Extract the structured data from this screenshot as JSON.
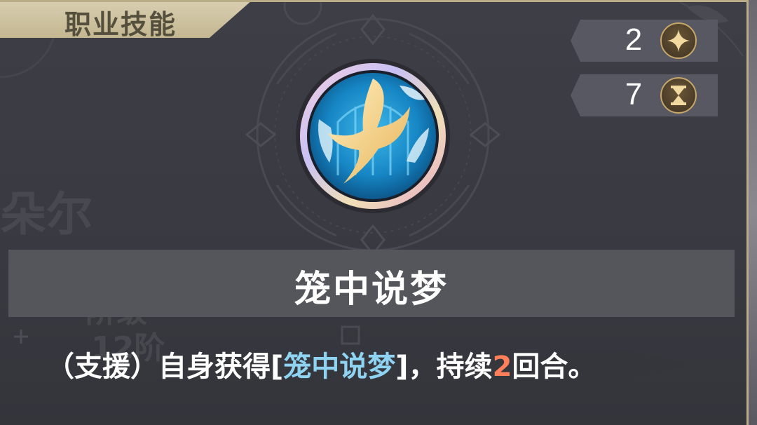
{
  "tab": {
    "label": "职业技能"
  },
  "background": {
    "ghost_name": "朵尔",
    "ghost_stage_label": "阶级",
    "ghost_stage_value": "12阶"
  },
  "stats": [
    {
      "value": "2",
      "icon": "star-icon"
    },
    {
      "value": "7",
      "icon": "hourglass-icon"
    }
  ],
  "skill": {
    "name": "笼中说梦",
    "icon": "golden-bird-icon",
    "description": {
      "prefix": "（支援）自身获得[",
      "keyword": "笼中说梦",
      "middle": "]，持续",
      "number": "2",
      "suffix": "回合。"
    }
  },
  "colors": {
    "panel_bg": "#3e3e47",
    "gold_border": "#b9ad88",
    "keyword_blue": "#8fd3f2",
    "number_orange": "#ff7f5a"
  }
}
